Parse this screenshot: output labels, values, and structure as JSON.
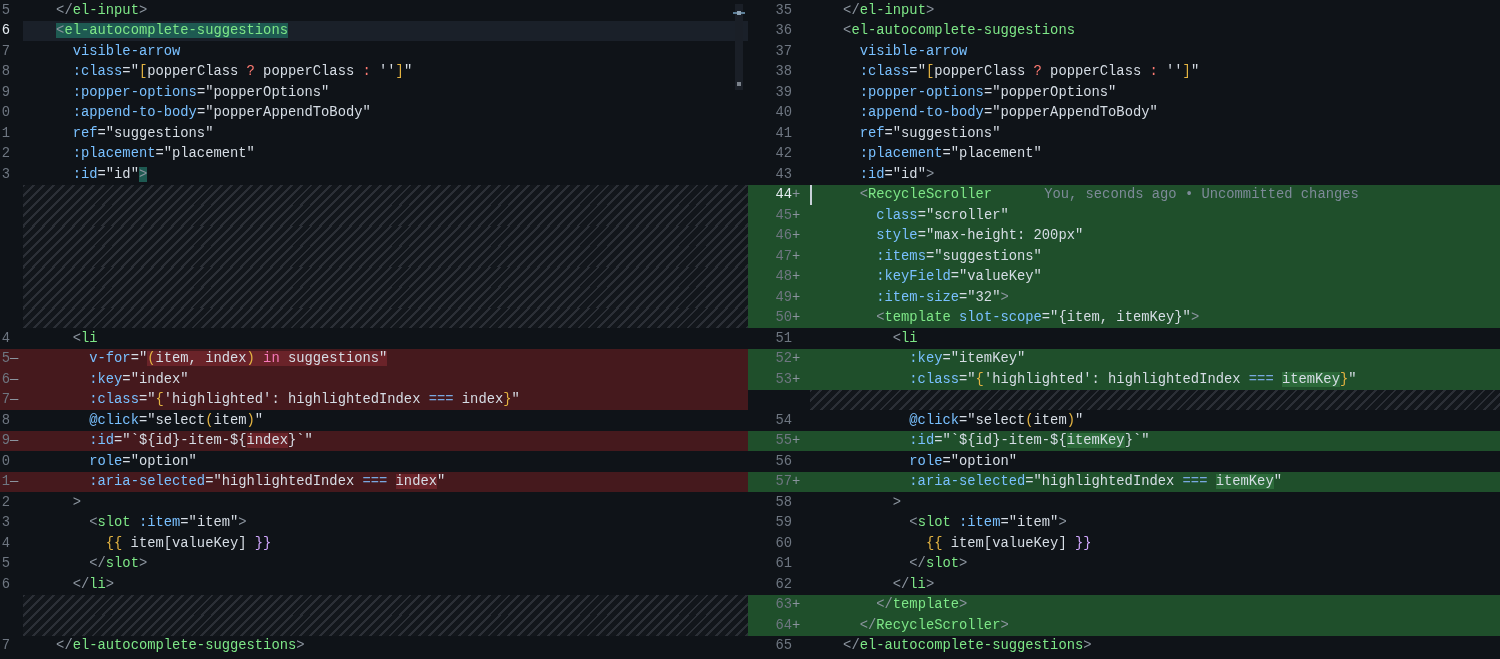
{
  "panes": [
    {
      "overview": true,
      "rows": [
        {
          "kind": "context",
          "number": "5",
          "current": false,
          "indent": "    ",
          "tokens": [
            {
              "t": "</",
              "kind": "punct"
            },
            {
              "t": "el-input",
              "kind": "tag"
            },
            {
              "t": ">",
              "kind": "punct"
            }
          ]
        },
        {
          "kind": "context",
          "number": "6",
          "current": true,
          "indent": "    ",
          "tokens": [
            {
              "t": "<",
              "kind": "punct",
              "match": true
            },
            {
              "t": "el-autocomplete-suggestions",
              "kind": "tag",
              "match": true
            }
          ]
        },
        {
          "kind": "context",
          "number": "7",
          "current": false,
          "indent": "      ",
          "tokens": [
            {
              "t": "visible-arrow",
              "kind": "attr"
            }
          ]
        },
        {
          "kind": "context",
          "number": "8",
          "current": false,
          "indent": "      ",
          "tokens": [
            {
              "t": ":class",
              "kind": "attr"
            },
            {
              "t": "=\"",
              "kind": "text"
            },
            {
              "t": "[",
              "kind": "bracket"
            },
            {
              "t": "popperClass ",
              "kind": "text"
            },
            {
              "t": "?",
              "kind": "op"
            },
            {
              "t": " popperClass ",
              "kind": "text"
            },
            {
              "t": ":",
              "kind": "op"
            },
            {
              "t": " ''",
              "kind": "text"
            },
            {
              "t": "]",
              "kind": "bracket"
            },
            {
              "t": "\"",
              "kind": "text"
            }
          ]
        },
        {
          "kind": "context",
          "number": "9",
          "current": false,
          "indent": "      ",
          "tokens": [
            {
              "t": ":popper-options",
              "kind": "attr"
            },
            {
              "t": "=\"popperOptions\"",
              "kind": "text"
            }
          ]
        },
        {
          "kind": "context",
          "number": "0",
          "current": false,
          "indent": "      ",
          "tokens": [
            {
              "t": ":append-to-body",
              "kind": "attr"
            },
            {
              "t": "=\"popperAppendToBody\"",
              "kind": "text"
            }
          ]
        },
        {
          "kind": "context",
          "number": "1",
          "current": false,
          "indent": "      ",
          "tokens": [
            {
              "t": "ref",
              "kind": "attr"
            },
            {
              "t": "=\"suggestions\"",
              "kind": "text"
            }
          ]
        },
        {
          "kind": "context",
          "number": "2",
          "current": false,
          "indent": "      ",
          "tokens": [
            {
              "t": ":placement",
              "kind": "attr"
            },
            {
              "t": "=\"placement\"",
              "kind": "text"
            }
          ]
        },
        {
          "kind": "context",
          "number": "3",
          "current": false,
          "indent": "      ",
          "tokens": [
            {
              "t": ":id",
              "kind": "attr"
            },
            {
              "t": "=\"id\"",
              "kind": "text"
            },
            {
              "t": ">",
              "kind": "punct",
              "match": true
            }
          ]
        },
        {
          "kind": "filler"
        },
        {
          "kind": "filler"
        },
        {
          "kind": "filler"
        },
        {
          "kind": "filler"
        },
        {
          "kind": "filler"
        },
        {
          "kind": "filler"
        },
        {
          "kind": "filler"
        },
        {
          "kind": "context",
          "number": "4",
          "current": false,
          "indent": "      ",
          "tokens": [
            {
              "t": "<",
              "kind": "punct"
            },
            {
              "t": "li",
              "kind": "tag"
            }
          ]
        },
        {
          "kind": "removed",
          "number": "5",
          "marker": "—",
          "current": false,
          "indent": "        ",
          "tokens": [
            {
              "t": "v-for",
              "kind": "attr"
            },
            {
              "t": "=\"",
              "kind": "text"
            },
            {
              "t": "(",
              "kind": "bracket",
              "emphasized": true
            },
            {
              "t": "item, index",
              "kind": "text",
              "emphasized": true
            },
            {
              "t": ")",
              "kind": "bracket",
              "emphasized": true
            },
            {
              "t": " in",
              "kind": "keyword",
              "emphasized": true
            },
            {
              "t": " suggestions\"",
              "kind": "text",
              "emphasized": true
            }
          ]
        },
        {
          "kind": "removed",
          "number": "6",
          "marker": "—",
          "current": false,
          "indent": "        ",
          "tokens": [
            {
              "t": ":key",
              "kind": "attr"
            },
            {
              "t": "=\"index\"",
              "kind": "text"
            }
          ]
        },
        {
          "kind": "removed",
          "number": "7",
          "marker": "—",
          "current": false,
          "indent": "        ",
          "tokens": [
            {
              "t": ":class",
              "kind": "attr"
            },
            {
              "t": "=\"",
              "kind": "text"
            },
            {
              "t": "{",
              "kind": "bracket"
            },
            {
              "t": "'highlighted': highlightedIndex ",
              "kind": "text"
            },
            {
              "t": "===",
              "kind": "eq"
            },
            {
              "t": " index",
              "kind": "text"
            },
            {
              "t": "}",
              "kind": "bracket"
            },
            {
              "t": "\"",
              "kind": "text"
            }
          ]
        },
        {
          "kind": "context",
          "number": "8",
          "current": false,
          "indent": "        ",
          "tokens": [
            {
              "t": "@click",
              "kind": "attr"
            },
            {
              "t": "=\"select",
              "kind": "text"
            },
            {
              "t": "(",
              "kind": "bracket"
            },
            {
              "t": "item",
              "kind": "text"
            },
            {
              "t": ")",
              "kind": "bracket"
            },
            {
              "t": "\"",
              "kind": "text"
            }
          ]
        },
        {
          "kind": "removed",
          "number": "9",
          "marker": "—",
          "current": false,
          "indent": "        ",
          "tokens": [
            {
              "t": ":id",
              "kind": "attr"
            },
            {
              "t": "=\"`${id}-item-${",
              "kind": "text"
            },
            {
              "t": "index",
              "kind": "text",
              "emphasized": true
            },
            {
              "t": "}`\"",
              "kind": "text"
            }
          ]
        },
        {
          "kind": "context",
          "number": "0",
          "current": false,
          "indent": "        ",
          "tokens": [
            {
              "t": "role",
              "kind": "attr"
            },
            {
              "t": "=\"option\"",
              "kind": "text"
            }
          ]
        },
        {
          "kind": "removed",
          "number": "1",
          "marker": "—",
          "current": false,
          "indent": "        ",
          "tokens": [
            {
              "t": ":aria-selected",
              "kind": "attr"
            },
            {
              "t": "=\"highlightedIndex ",
              "kind": "text"
            },
            {
              "t": "=== ",
              "kind": "eq"
            },
            {
              "t": "index",
              "kind": "text",
              "emphasized": true
            },
            {
              "t": "\"",
              "kind": "text"
            }
          ]
        },
        {
          "kind": "context",
          "number": "2",
          "current": false,
          "indent": "      ",
          "tokens": [
            {
              "t": ">",
              "kind": "punct"
            }
          ]
        },
        {
          "kind": "context",
          "number": "3",
          "current": false,
          "indent": "        ",
          "tokens": [
            {
              "t": "<",
              "kind": "punct"
            },
            {
              "t": "slot",
              "kind": "tag"
            },
            {
              "t": " :item",
              "kind": "attr"
            },
            {
              "t": "=\"item\"",
              "kind": "text"
            },
            {
              "t": ">",
              "kind": "punct"
            }
          ]
        },
        {
          "kind": "context",
          "number": "4",
          "current": false,
          "indent": "          ",
          "tokens": [
            {
              "t": "{{",
              "kind": "bracket"
            },
            {
              "t": " item[valueKey] ",
              "kind": "text"
            },
            {
              "t": "}}",
              "kind": "bracket2"
            }
          ]
        },
        {
          "kind": "context",
          "number": "5",
          "current": false,
          "indent": "        ",
          "tokens": [
            {
              "t": "</",
              "kind": "punct"
            },
            {
              "t": "slot",
              "kind": "tag"
            },
            {
              "t": ">",
              "kind": "punct"
            }
          ]
        },
        {
          "kind": "context",
          "number": "6",
          "current": false,
          "indent": "      ",
          "tokens": [
            {
              "t": "</",
              "kind": "punct"
            },
            {
              "t": "li",
              "kind": "tag"
            },
            {
              "t": ">",
              "kind": "punct"
            }
          ]
        },
        {
          "kind": "filler"
        },
        {
          "kind": "filler"
        },
        {
          "kind": "context",
          "number": "7",
          "current": false,
          "indent": "    ",
          "tokens": [
            {
              "t": "</",
              "kind": "punct"
            },
            {
              "t": "el-autocomplete-suggestions",
              "kind": "tag"
            },
            {
              "t": ">",
              "kind": "punct"
            }
          ]
        }
      ]
    },
    {
      "overview": false,
      "rows": [
        {
          "kind": "context",
          "number": "35",
          "current": false,
          "indent": "    ",
          "tokens": [
            {
              "t": "</",
              "kind": "punct"
            },
            {
              "t": "el-input",
              "kind": "tag"
            },
            {
              "t": ">",
              "kind": "punct"
            }
          ]
        },
        {
          "kind": "context",
          "number": "36",
          "current": false,
          "indent": "    ",
          "tokens": [
            {
              "t": "<",
              "kind": "punct"
            },
            {
              "t": "el-autocomplete-suggestions",
              "kind": "tag"
            }
          ]
        },
        {
          "kind": "context",
          "number": "37",
          "current": false,
          "indent": "      ",
          "tokens": [
            {
              "t": "visible-arrow",
              "kind": "attr"
            }
          ]
        },
        {
          "kind": "context",
          "number": "38",
          "current": false,
          "indent": "      ",
          "tokens": [
            {
              "t": ":class",
              "kind": "attr"
            },
            {
              "t": "=\"",
              "kind": "text"
            },
            {
              "t": "[",
              "kind": "bracket"
            },
            {
              "t": "popperClass ",
              "kind": "text"
            },
            {
              "t": "?",
              "kind": "op"
            },
            {
              "t": " popperClass ",
              "kind": "text"
            },
            {
              "t": ":",
              "kind": "op"
            },
            {
              "t": " ''",
              "kind": "text"
            },
            {
              "t": "]",
              "kind": "bracket"
            },
            {
              "t": "\"",
              "kind": "text"
            }
          ]
        },
        {
          "kind": "context",
          "number": "39",
          "current": false,
          "indent": "      ",
          "tokens": [
            {
              "t": ":popper-options",
              "kind": "attr"
            },
            {
              "t": "=\"popperOptions\"",
              "kind": "text"
            }
          ]
        },
        {
          "kind": "context",
          "number": "40",
          "current": false,
          "indent": "      ",
          "tokens": [
            {
              "t": ":append-to-body",
              "kind": "attr"
            },
            {
              "t": "=\"popperAppendToBody\"",
              "kind": "text"
            }
          ]
        },
        {
          "kind": "context",
          "number": "41",
          "current": false,
          "indent": "      ",
          "tokens": [
            {
              "t": "ref",
              "kind": "attr"
            },
            {
              "t": "=\"suggestions\"",
              "kind": "text"
            }
          ]
        },
        {
          "kind": "context",
          "number": "42",
          "current": false,
          "indent": "      ",
          "tokens": [
            {
              "t": ":placement",
              "kind": "attr"
            },
            {
              "t": "=\"placement\"",
              "kind": "text"
            }
          ]
        },
        {
          "kind": "context",
          "number": "43",
          "current": false,
          "indent": "      ",
          "tokens": [
            {
              "t": ":id",
              "kind": "attr"
            },
            {
              "t": "=\"id\"",
              "kind": "text"
            },
            {
              "t": ">",
              "kind": "punct"
            }
          ]
        },
        {
          "kind": "added",
          "number": "44",
          "marker": "+",
          "current": true,
          "indent": "      ",
          "blame": "You, seconds ago • Uncommitted changes",
          "tokens": [
            {
              "t": "<",
              "kind": "punct"
            },
            {
              "t": "RecycleScroller",
              "kind": "tag"
            }
          ]
        },
        {
          "kind": "added",
          "number": "45",
          "marker": "+",
          "current": false,
          "indent": "        ",
          "tokens": [
            {
              "t": "class",
              "kind": "attr"
            },
            {
              "t": "=\"scroller\"",
              "kind": "text"
            }
          ]
        },
        {
          "kind": "added",
          "number": "46",
          "marker": "+",
          "current": false,
          "indent": "        ",
          "tokens": [
            {
              "t": "style",
              "kind": "attr"
            },
            {
              "t": "=\"max-height: 200px\"",
              "kind": "text"
            }
          ]
        },
        {
          "kind": "added",
          "number": "47",
          "marker": "+",
          "current": false,
          "indent": "        ",
          "tokens": [
            {
              "t": ":items",
              "kind": "attr"
            },
            {
              "t": "=\"suggestions\"",
              "kind": "text"
            }
          ]
        },
        {
          "kind": "added",
          "number": "48",
          "marker": "+",
          "current": false,
          "indent": "        ",
          "tokens": [
            {
              "t": ":keyField",
              "kind": "attr"
            },
            {
              "t": "=\"valueKey\"",
              "kind": "text"
            }
          ]
        },
        {
          "kind": "added",
          "number": "49",
          "marker": "+",
          "current": false,
          "indent": "        ",
          "tokens": [
            {
              "t": ":item-size",
              "kind": "attr"
            },
            {
              "t": "=\"32\"",
              "kind": "text"
            },
            {
              "t": ">",
              "kind": "punct"
            }
          ]
        },
        {
          "kind": "added",
          "number": "50",
          "marker": "+",
          "current": false,
          "indent": "        ",
          "tokens": [
            {
              "t": "<",
              "kind": "punct"
            },
            {
              "t": "template",
              "kind": "tag"
            },
            {
              "t": " slot-scope",
              "kind": "attr"
            },
            {
              "t": "=\"{item, itemKey}\"",
              "kind": "text"
            },
            {
              "t": ">",
              "kind": "punct"
            }
          ]
        },
        {
          "kind": "context",
          "number": "51",
          "current": false,
          "indent": "          ",
          "tokens": [
            {
              "t": "<",
              "kind": "punct"
            },
            {
              "t": "li",
              "kind": "tag"
            }
          ]
        },
        {
          "kind": "added",
          "number": "52",
          "marker": "+",
          "current": false,
          "indent": "            ",
          "tokens": [
            {
              "t": ":key",
              "kind": "attr"
            },
            {
              "t": "=\"itemKey\"",
              "kind": "text"
            }
          ]
        },
        {
          "kind": "added",
          "number": "53",
          "marker": "+",
          "current": false,
          "indent": "            ",
          "tokens": [
            {
              "t": ":class",
              "kind": "attr"
            },
            {
              "t": "=\"",
              "kind": "text"
            },
            {
              "t": "{",
              "kind": "bracket"
            },
            {
              "t": "'highlighted': highlightedIndex ",
              "kind": "text"
            },
            {
              "t": "=== ",
              "kind": "eq"
            },
            {
              "t": "itemKey",
              "kind": "text",
              "emphasized": true
            },
            {
              "t": "}",
              "kind": "bracket"
            },
            {
              "t": "\"",
              "kind": "text"
            }
          ]
        },
        {
          "kind": "filler"
        },
        {
          "kind": "context",
          "number": "54",
          "current": false,
          "indent": "            ",
          "tokens": [
            {
              "t": "@click",
              "kind": "attr"
            },
            {
              "t": "=\"select",
              "kind": "text"
            },
            {
              "t": "(",
              "kind": "bracket"
            },
            {
              "t": "item",
              "kind": "text"
            },
            {
              "t": ")",
              "kind": "bracket"
            },
            {
              "t": "\"",
              "kind": "text"
            }
          ]
        },
        {
          "kind": "added",
          "number": "55",
          "marker": "+",
          "current": false,
          "indent": "            ",
          "tokens": [
            {
              "t": ":id",
              "kind": "attr"
            },
            {
              "t": "=\"`${id}-item-${",
              "kind": "text"
            },
            {
              "t": "itemKey",
              "kind": "text",
              "emphasized": true
            },
            {
              "t": "}`\"",
              "kind": "text"
            }
          ]
        },
        {
          "kind": "context",
          "number": "56",
          "current": false,
          "indent": "            ",
          "tokens": [
            {
              "t": "role",
              "kind": "attr"
            },
            {
              "t": "=\"option\"",
              "kind": "text"
            }
          ]
        },
        {
          "kind": "added",
          "number": "57",
          "marker": "+",
          "current": false,
          "indent": "            ",
          "tokens": [
            {
              "t": ":aria-selected",
              "kind": "attr"
            },
            {
              "t": "=\"highlightedIndex ",
              "kind": "text"
            },
            {
              "t": "=== ",
              "kind": "eq"
            },
            {
              "t": "itemKey",
              "kind": "text",
              "emphasized": true
            },
            {
              "t": "\"",
              "kind": "text"
            }
          ]
        },
        {
          "kind": "context",
          "number": "58",
          "current": false,
          "indent": "          ",
          "tokens": [
            {
              "t": ">",
              "kind": "punct"
            }
          ]
        },
        {
          "kind": "context",
          "number": "59",
          "current": false,
          "indent": "            ",
          "tokens": [
            {
              "t": "<",
              "kind": "punct"
            },
            {
              "t": "slot",
              "kind": "tag"
            },
            {
              "t": " :item",
              "kind": "attr"
            },
            {
              "t": "=\"item\"",
              "kind": "text"
            },
            {
              "t": ">",
              "kind": "punct"
            }
          ]
        },
        {
          "kind": "context",
          "number": "60",
          "current": false,
          "indent": "              ",
          "tokens": [
            {
              "t": "{{",
              "kind": "bracket"
            },
            {
              "t": " item[valueKey] ",
              "kind": "text"
            },
            {
              "t": "}}",
              "kind": "bracket2"
            }
          ]
        },
        {
          "kind": "context",
          "number": "61",
          "current": false,
          "indent": "            ",
          "tokens": [
            {
              "t": "</",
              "kind": "punct"
            },
            {
              "t": "slot",
              "kind": "tag"
            },
            {
              "t": ">",
              "kind": "punct"
            }
          ]
        },
        {
          "kind": "context",
          "number": "62",
          "current": false,
          "indent": "          ",
          "tokens": [
            {
              "t": "</",
              "kind": "punct"
            },
            {
              "t": "li",
              "kind": "tag"
            },
            {
              "t": ">",
              "kind": "punct"
            }
          ]
        },
        {
          "kind": "added",
          "number": "63",
          "marker": "+",
          "current": false,
          "indent": "        ",
          "tokens": [
            {
              "t": "</",
              "kind": "punct"
            },
            {
              "t": "template",
              "kind": "tag"
            },
            {
              "t": ">",
              "kind": "punct"
            }
          ]
        },
        {
          "kind": "added",
          "number": "64",
          "marker": "+",
          "current": false,
          "indent": "      ",
          "tokens": [
            {
              "t": "</",
              "kind": "punct"
            },
            {
              "t": "RecycleScroller",
              "kind": "tag"
            },
            {
              "t": ">",
              "kind": "punct"
            }
          ]
        },
        {
          "kind": "context",
          "number": "65",
          "current": false,
          "indent": "    ",
          "tokens": [
            {
              "t": "</",
              "kind": "punct"
            },
            {
              "t": "el-autocomplete-suggestions",
              "kind": "tag"
            },
            {
              "t": ">",
              "kind": "punct"
            }
          ]
        }
      ]
    }
  ]
}
